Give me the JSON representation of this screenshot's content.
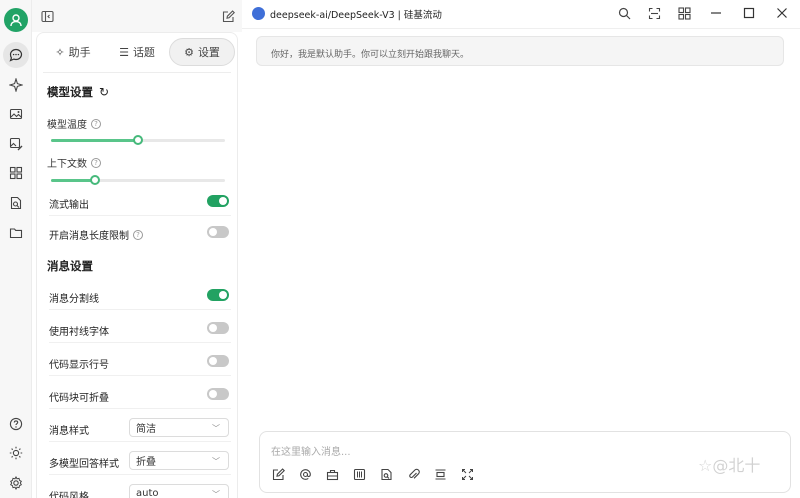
{
  "header": {
    "model_title": "deepseek-ai/DeepSeek-V3 | 硅基流动"
  },
  "tabs": [
    {
      "label": "助手",
      "icon": "sparkle-icon"
    },
    {
      "label": "话题",
      "icon": "list-icon"
    },
    {
      "label": "设置",
      "icon": "gear-icon",
      "active": true
    }
  ],
  "model_settings": {
    "title": "模型设置",
    "temperature_label": "模型温度",
    "temperature_level": 0.5,
    "context_label": "上下文数",
    "context_level": 0.25,
    "stream_label": "流式输出",
    "stream_on": true,
    "max_length_label": "开启消息长度限制",
    "max_length_on": false
  },
  "message_settings": {
    "title": "消息设置",
    "divider_label": "消息分割线",
    "divider_on": true,
    "serif_label": "使用衬线字体",
    "serif_on": false,
    "code_lines_label": "代码显示行号",
    "code_lines_on": false,
    "code_fold_label": "代码块可折叠",
    "code_fold_on": false,
    "msg_style_label": "消息样式",
    "msg_style_value": "简洁",
    "multi_style_label": "多模型回答样式",
    "multi_style_value": "折叠",
    "code_style_label": "代码风格",
    "code_style_value": "auto"
  },
  "chat": {
    "greeting": "你好，我是默认助手。你可以立刻开始跟我聊天。"
  },
  "input": {
    "placeholder": "在这里输入消息..."
  },
  "watermark": "☆@北十",
  "colors": {
    "accent": "#22a262",
    "avatar": "#21a366",
    "model_badge": "#3f6fd8"
  }
}
